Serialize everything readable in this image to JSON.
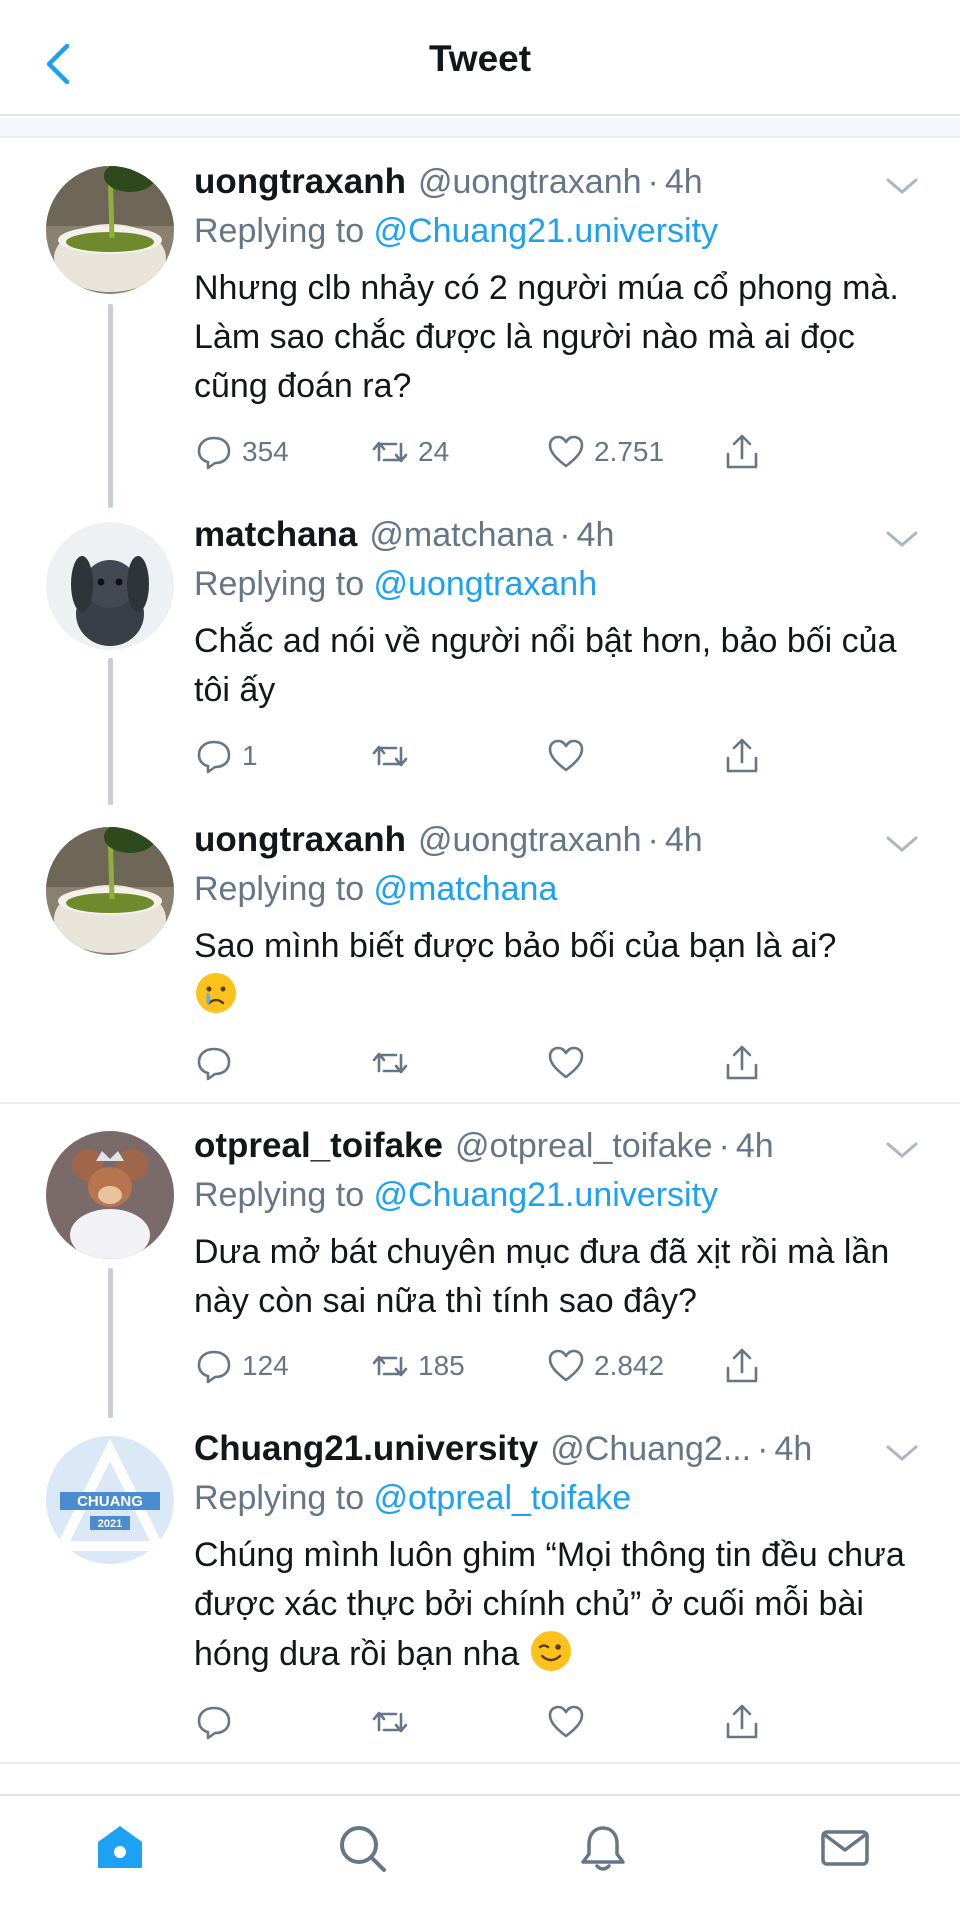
{
  "header": {
    "title": "Tweet"
  },
  "colors": {
    "accent": "#1da1f2",
    "secondary_text": "#657786",
    "divider": "#e6ecf0"
  },
  "tweets": [
    {
      "name": "uongtraxanh",
      "handle": "@uongtraxanh",
      "time": "4h",
      "reply_prefix": "Replying to ",
      "reply_to": "@Chuang21.university",
      "text": "Nhưng clb nhảy có 2 người múa cổ phong mà. Làm sao chắc được là người nào mà ai đọc cũng đoán ra?",
      "replies": "354",
      "retweets": "24",
      "likes": "2.751",
      "avatar_icon": "green-tea-avatar"
    },
    {
      "name": "matchana",
      "handle": "@matchana",
      "time": "4h",
      "reply_prefix": "Replying to ",
      "reply_to": "@uongtraxanh",
      "text": "Chắc ad nói về người nổi bật hơn, bảo bối của tôi ấy",
      "replies": "1",
      "retweets": "",
      "likes": "",
      "avatar_icon": "rabbit-avatar"
    },
    {
      "name": "uongtraxanh",
      "handle": "@uongtraxanh",
      "time": "4h",
      "reply_prefix": "Replying to ",
      "reply_to": "@matchana",
      "text": "Sao mình biết được bảo bối của bạn là ai?",
      "emoji": "crying-face",
      "replies": "",
      "retweets": "",
      "likes": "",
      "avatar_icon": "green-tea-avatar"
    },
    {
      "name": "otpreal_toifake",
      "handle": "@otpreal_toifake",
      "time": "4h",
      "reply_prefix": "Replying to ",
      "reply_to": "@Chuang21.university",
      "text": "Dưa mở bát chuyên mục đưa đã xịt rồi mà lần này còn sai nữa thì tính sao đây?",
      "replies": "124",
      "retweets": "185",
      "likes": "2.842",
      "avatar_icon": "jerry-mouse-avatar"
    },
    {
      "name": "Chuang21.university",
      "handle": "@Chuang2...",
      "time": "4h",
      "reply_prefix": "Replying to ",
      "reply_to": "@otpreal_toifake",
      "text": "Chúng mình luôn ghim “Mọi thông tin đều chưa được xác thực bởi chính chủ” ở cuối mỗi bài hóng dưa rồi bạn nha",
      "emoji": "winking-face",
      "replies": "",
      "retweets": "",
      "likes": "",
      "avatar_icon": "chuang-logo-avatar",
      "avatar_text": "CHUANG",
      "avatar_year": "2021"
    }
  ],
  "tabbar": {
    "items": [
      "home-icon",
      "search-icon",
      "notifications-icon",
      "messages-icon"
    ],
    "active": "home-icon"
  }
}
